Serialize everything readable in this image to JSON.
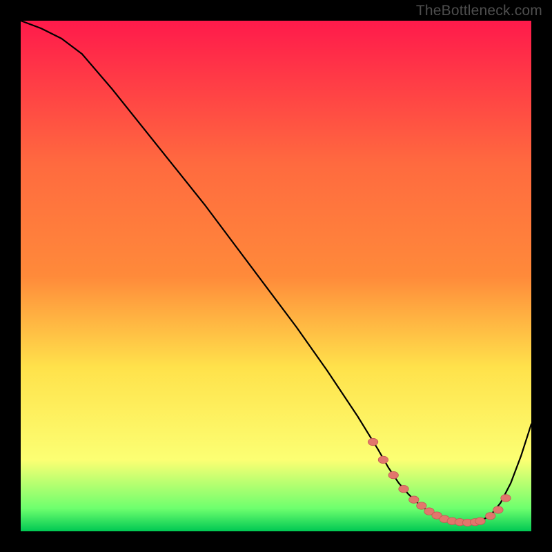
{
  "watermark": "TheBottleneck.com",
  "colors": {
    "frame": "#000000",
    "gradient_top": "#ff1a4b",
    "gradient_mid1": "#ff8a3a",
    "gradient_mid2": "#ffe24b",
    "gradient_low": "#fcff73",
    "gradient_bottom1": "#6eff6e",
    "gradient_bottom2": "#00c853",
    "curve": "#000000",
    "marker_fill": "#e2766c",
    "marker_stroke": "#c45a55"
  },
  "chart_data": {
    "type": "line",
    "title": "",
    "xlabel": "",
    "ylabel": "",
    "xlim": [
      0,
      100
    ],
    "ylim": [
      0,
      100
    ],
    "curve": {
      "x": [
        0,
        4,
        8,
        12,
        18,
        24,
        30,
        36,
        42,
        48,
        54,
        60,
        66,
        70,
        72,
        74,
        76,
        78,
        80,
        82,
        84,
        86,
        88,
        90,
        92,
        94,
        96,
        98,
        100
      ],
      "y": [
        100,
        98.5,
        96.5,
        93.5,
        86.5,
        79,
        71.5,
        64,
        56,
        48,
        40,
        31.5,
        22.5,
        16,
        12.5,
        9.5,
        7.2,
        5.3,
        3.8,
        2.7,
        2.0,
        1.7,
        1.7,
        2.0,
        3.1,
        5.6,
        9.5,
        14.8,
        21
      ]
    },
    "markers": {
      "x": [
        69,
        71,
        73,
        75,
        77,
        78.5,
        80,
        81.5,
        83,
        84.5,
        86,
        87.5,
        89,
        90,
        92,
        93.5,
        95
      ],
      "y": [
        17.5,
        14,
        11,
        8.3,
        6.2,
        5.0,
        3.9,
        3.1,
        2.4,
        2.0,
        1.8,
        1.7,
        1.8,
        2.0,
        3.0,
        4.2,
        6.5
      ]
    }
  }
}
